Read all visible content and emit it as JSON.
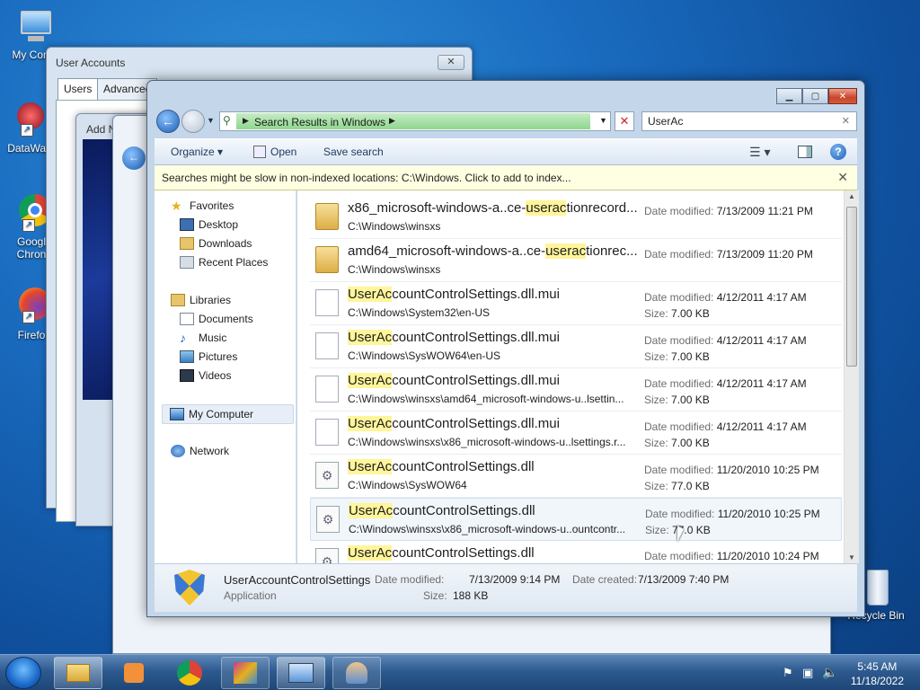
{
  "desktop": {
    "icons": [
      {
        "label": "My Comp"
      },
      {
        "label": "DataWag"
      },
      {
        "label": "Googl\nChron"
      },
      {
        "label": "Firefo"
      },
      {
        "label": "Recycle Bin"
      }
    ]
  },
  "user_accounts": {
    "title": "User Accounts",
    "tabs": [
      "Users",
      "Advanced"
    ]
  },
  "add_dialog": {
    "title": "Add N"
  },
  "explorer": {
    "address": "Search Results in Windows",
    "search_value": "UserAc",
    "toolbar": {
      "organize": "Organize",
      "open": "Open",
      "save_search": "Save search"
    },
    "infobar": "Searches might be slow in non-indexed locations: C:\\Windows. Click to add to index...",
    "nav": {
      "favorites": "Favorites",
      "desktop": "Desktop",
      "downloads": "Downloads",
      "recent": "Recent Places",
      "libraries": "Libraries",
      "documents": "Documents",
      "music": "Music",
      "pictures": "Pictures",
      "videos": "Videos",
      "computer": "My Computer",
      "network": "Network"
    },
    "results": [
      {
        "pre": "x86_microsoft-windows-a..ce-",
        "hl": "userac",
        "post": "tionrecord...",
        "path": "C:\\Windows\\winsxs",
        "type": "folder",
        "m1k": "Date modified:",
        "m1v": "7/13/2009 11:21 PM",
        "m2k": "",
        "m2v": ""
      },
      {
        "pre": "amd64_microsoft-windows-a..ce-",
        "hl": "userac",
        "post": "tionrec...",
        "path": "C:\\Windows\\winsxs",
        "type": "folder",
        "m1k": "Date modified:",
        "m1v": "7/13/2009 11:20 PM",
        "m2k": "",
        "m2v": ""
      },
      {
        "pre": "",
        "hl": "UserAc",
        "post": "countControlSettings.dll.mui",
        "path": "C:\\Windows\\System32\\en-US",
        "type": "file",
        "m1k": "Date modified:",
        "m1v": "4/12/2011 4:17 AM",
        "m2k": "Size:",
        "m2v": "7.00 KB"
      },
      {
        "pre": "",
        "hl": "UserAc",
        "post": "countControlSettings.dll.mui",
        "path": "C:\\Windows\\SysWOW64\\en-US",
        "type": "file",
        "m1k": "Date modified:",
        "m1v": "4/12/2011 4:17 AM",
        "m2k": "Size:",
        "m2v": "7.00 KB"
      },
      {
        "pre": "",
        "hl": "UserAc",
        "post": "countControlSettings.dll.mui",
        "path": "C:\\Windows\\winsxs\\amd64_microsoft-windows-u..lsettin...",
        "type": "file",
        "m1k": "Date modified:",
        "m1v": "4/12/2011 4:17 AM",
        "m2k": "Size:",
        "m2v": "7.00 KB"
      },
      {
        "pre": "",
        "hl": "UserAc",
        "post": "countControlSettings.dll.mui",
        "path": "C:\\Windows\\winsxs\\x86_microsoft-windows-u..lsettings.r...",
        "type": "file",
        "m1k": "Date modified:",
        "m1v": "4/12/2011 4:17 AM",
        "m2k": "Size:",
        "m2v": "7.00 KB"
      },
      {
        "pre": "",
        "hl": "UserAc",
        "post": "countControlSettings.dll",
        "path": "C:\\Windows\\SysWOW64",
        "type": "dll",
        "m1k": "Date modified:",
        "m1v": "11/20/2010 10:25 PM",
        "m2k": "Size:",
        "m2v": "77.0 KB"
      },
      {
        "pre": "",
        "hl": "UserAc",
        "post": "countControlSettings.dll",
        "path": "C:\\Windows\\winsxs\\x86_microsoft-windows-u..ountcontr...",
        "type": "dll",
        "m1k": "Date modified:",
        "m1v": "11/20/2010 10:25 PM",
        "m2k": "Size:",
        "m2v": "77.0 KB"
      },
      {
        "pre": "",
        "hl": "UserAc",
        "post": "countControlSettings.dll",
        "path": "",
        "type": "dll",
        "m1k": "Date modified:",
        "m1v": "11/20/2010 10:24 PM",
        "m2k": "",
        "m2v": ""
      }
    ],
    "details": {
      "name": "UserAccountControlSettings",
      "type": "Application",
      "modified_k": "Date modified:",
      "modified_v": "7/13/2009 9:14 PM",
      "created_k": "Date created:",
      "created_v": "7/13/2009 7:40 PM",
      "size_k": "Size:",
      "size_v": "188 KB"
    }
  },
  "taskbar": {
    "time": "5:45 AM",
    "date": "11/18/2022"
  }
}
